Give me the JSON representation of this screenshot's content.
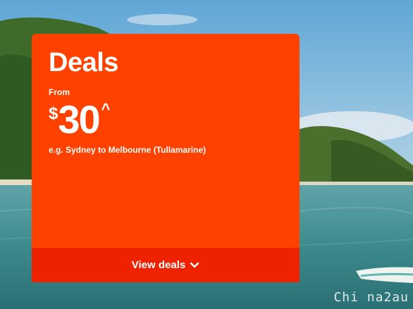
{
  "deals_card": {
    "title": "Deals",
    "from_label": "From",
    "currency_symbol": "$",
    "price": "30",
    "price_marker": "^",
    "example_route": "e.g. Sydney to Melbourne (Tullamarine)",
    "cta_label": "View deals",
    "cta_icon": "chevron-down-icon",
    "color": "#ff4100",
    "cta_color": "#ee2100"
  },
  "watermark": "Chi na2au"
}
